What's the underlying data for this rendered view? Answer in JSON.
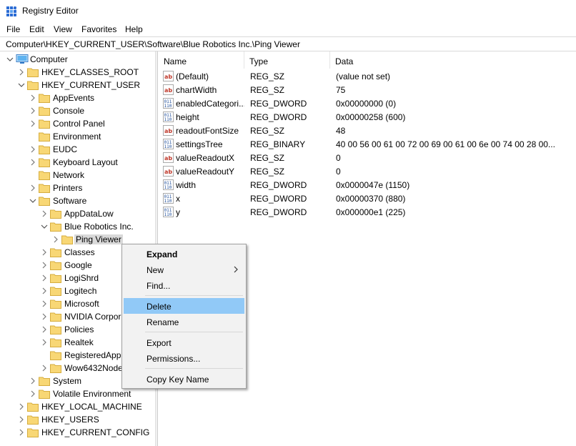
{
  "window": {
    "title": "Registry Editor"
  },
  "menubar": {
    "items": [
      "File",
      "Edit",
      "View",
      "Favorites",
      "Help"
    ]
  },
  "address": {
    "path": "Computer\\HKEY_CURRENT_USER\\Software\\Blue Robotics Inc.\\Ping Viewer"
  },
  "tree": {
    "items": [
      {
        "label": "Computer",
        "level": 0,
        "expanded": true,
        "icon": "computer-icon"
      },
      {
        "label": "HKEY_CLASSES_ROOT",
        "level": 1,
        "expanded": false
      },
      {
        "label": "HKEY_CURRENT_USER",
        "level": 1,
        "expanded": true
      },
      {
        "label": "AppEvents",
        "level": 2,
        "expanded": false
      },
      {
        "label": "Console",
        "level": 2,
        "expanded": false
      },
      {
        "label": "Control Panel",
        "level": 2,
        "expanded": false
      },
      {
        "label": "Environment",
        "level": 2,
        "expanded": null
      },
      {
        "label": "EUDC",
        "level": 2,
        "expanded": false
      },
      {
        "label": "Keyboard Layout",
        "level": 2,
        "expanded": false
      },
      {
        "label": "Network",
        "level": 2,
        "expanded": null
      },
      {
        "label": "Printers",
        "level": 2,
        "expanded": false
      },
      {
        "label": "Software",
        "level": 2,
        "expanded": true
      },
      {
        "label": "AppDataLow",
        "level": 3,
        "expanded": false
      },
      {
        "label": "Blue Robotics Inc.",
        "level": 3,
        "expanded": true
      },
      {
        "label": "Ping Viewer",
        "level": 4,
        "expanded": false,
        "selected": true
      },
      {
        "label": "Classes",
        "level": 3,
        "expanded": false
      },
      {
        "label": "Google",
        "level": 3,
        "expanded": false
      },
      {
        "label": "LogiShrd",
        "level": 3,
        "expanded": false
      },
      {
        "label": "Logitech",
        "level": 3,
        "expanded": false
      },
      {
        "label": "Microsoft",
        "level": 3,
        "expanded": false
      },
      {
        "label": "NVIDIA Corpor",
        "level": 3,
        "expanded": false
      },
      {
        "label": "Policies",
        "level": 3,
        "expanded": false
      },
      {
        "label": "Realtek",
        "level": 3,
        "expanded": false
      },
      {
        "label": "RegisteredApp",
        "level": 3,
        "expanded": null
      },
      {
        "label": "Wow6432Node",
        "level": 3,
        "expanded": false
      },
      {
        "label": "System",
        "level": 2,
        "expanded": false
      },
      {
        "label": "Volatile Environment",
        "level": 2,
        "expanded": false
      },
      {
        "label": "HKEY_LOCAL_MACHINE",
        "level": 1,
        "expanded": false
      },
      {
        "label": "HKEY_USERS",
        "level": 1,
        "expanded": false
      },
      {
        "label": "HKEY_CURRENT_CONFIG",
        "level": 1,
        "expanded": false
      }
    ]
  },
  "list": {
    "columns": {
      "name": "Name",
      "type": "Type",
      "data": "Data"
    },
    "rows": [
      {
        "name": "(Default)",
        "type": "REG_SZ",
        "data": "(value not set)",
        "icon": "string-value-icon"
      },
      {
        "name": "chartWidth",
        "type": "REG_SZ",
        "data": "75",
        "icon": "string-value-icon"
      },
      {
        "name": "enabledCategori...",
        "type": "REG_DWORD",
        "data": "0x00000000 (0)",
        "icon": "binary-value-icon"
      },
      {
        "name": "height",
        "type": "REG_DWORD",
        "data": "0x00000258 (600)",
        "icon": "binary-value-icon"
      },
      {
        "name": "readoutFontSize",
        "type": "REG_SZ",
        "data": "48",
        "icon": "string-value-icon"
      },
      {
        "name": "settingsTree",
        "type": "REG_BINARY",
        "data": "40 00 56 00 61 00 72 00 69 00 61 00 6e 00 74 00 28 00...",
        "icon": "binary-value-icon"
      },
      {
        "name": "valueReadoutX",
        "type": "REG_SZ",
        "data": "0",
        "icon": "string-value-icon"
      },
      {
        "name": "valueReadoutY",
        "type": "REG_SZ",
        "data": "0",
        "icon": "string-value-icon"
      },
      {
        "name": "width",
        "type": "REG_DWORD",
        "data": "0x0000047e (1150)",
        "icon": "binary-value-icon"
      },
      {
        "name": "x",
        "type": "REG_DWORD",
        "data": "0x00000370 (880)",
        "icon": "binary-value-icon"
      },
      {
        "name": "y",
        "type": "REG_DWORD",
        "data": "0x000000e1 (225)",
        "icon": "binary-value-icon"
      }
    ]
  },
  "context_menu": {
    "expand": "Expand",
    "new": "New",
    "find": "Find...",
    "delete": "Delete",
    "rename": "Rename",
    "export": "Export",
    "permissions": "Permissions...",
    "copy_key_name": "Copy Key Name",
    "hovered": "Delete"
  },
  "colors": {
    "hover": "#91c9f7",
    "selection": "#d9d9d9",
    "folder": "#f8d775",
    "string_icon": "#c0392b",
    "binary_icon": "#1f4e9a"
  }
}
